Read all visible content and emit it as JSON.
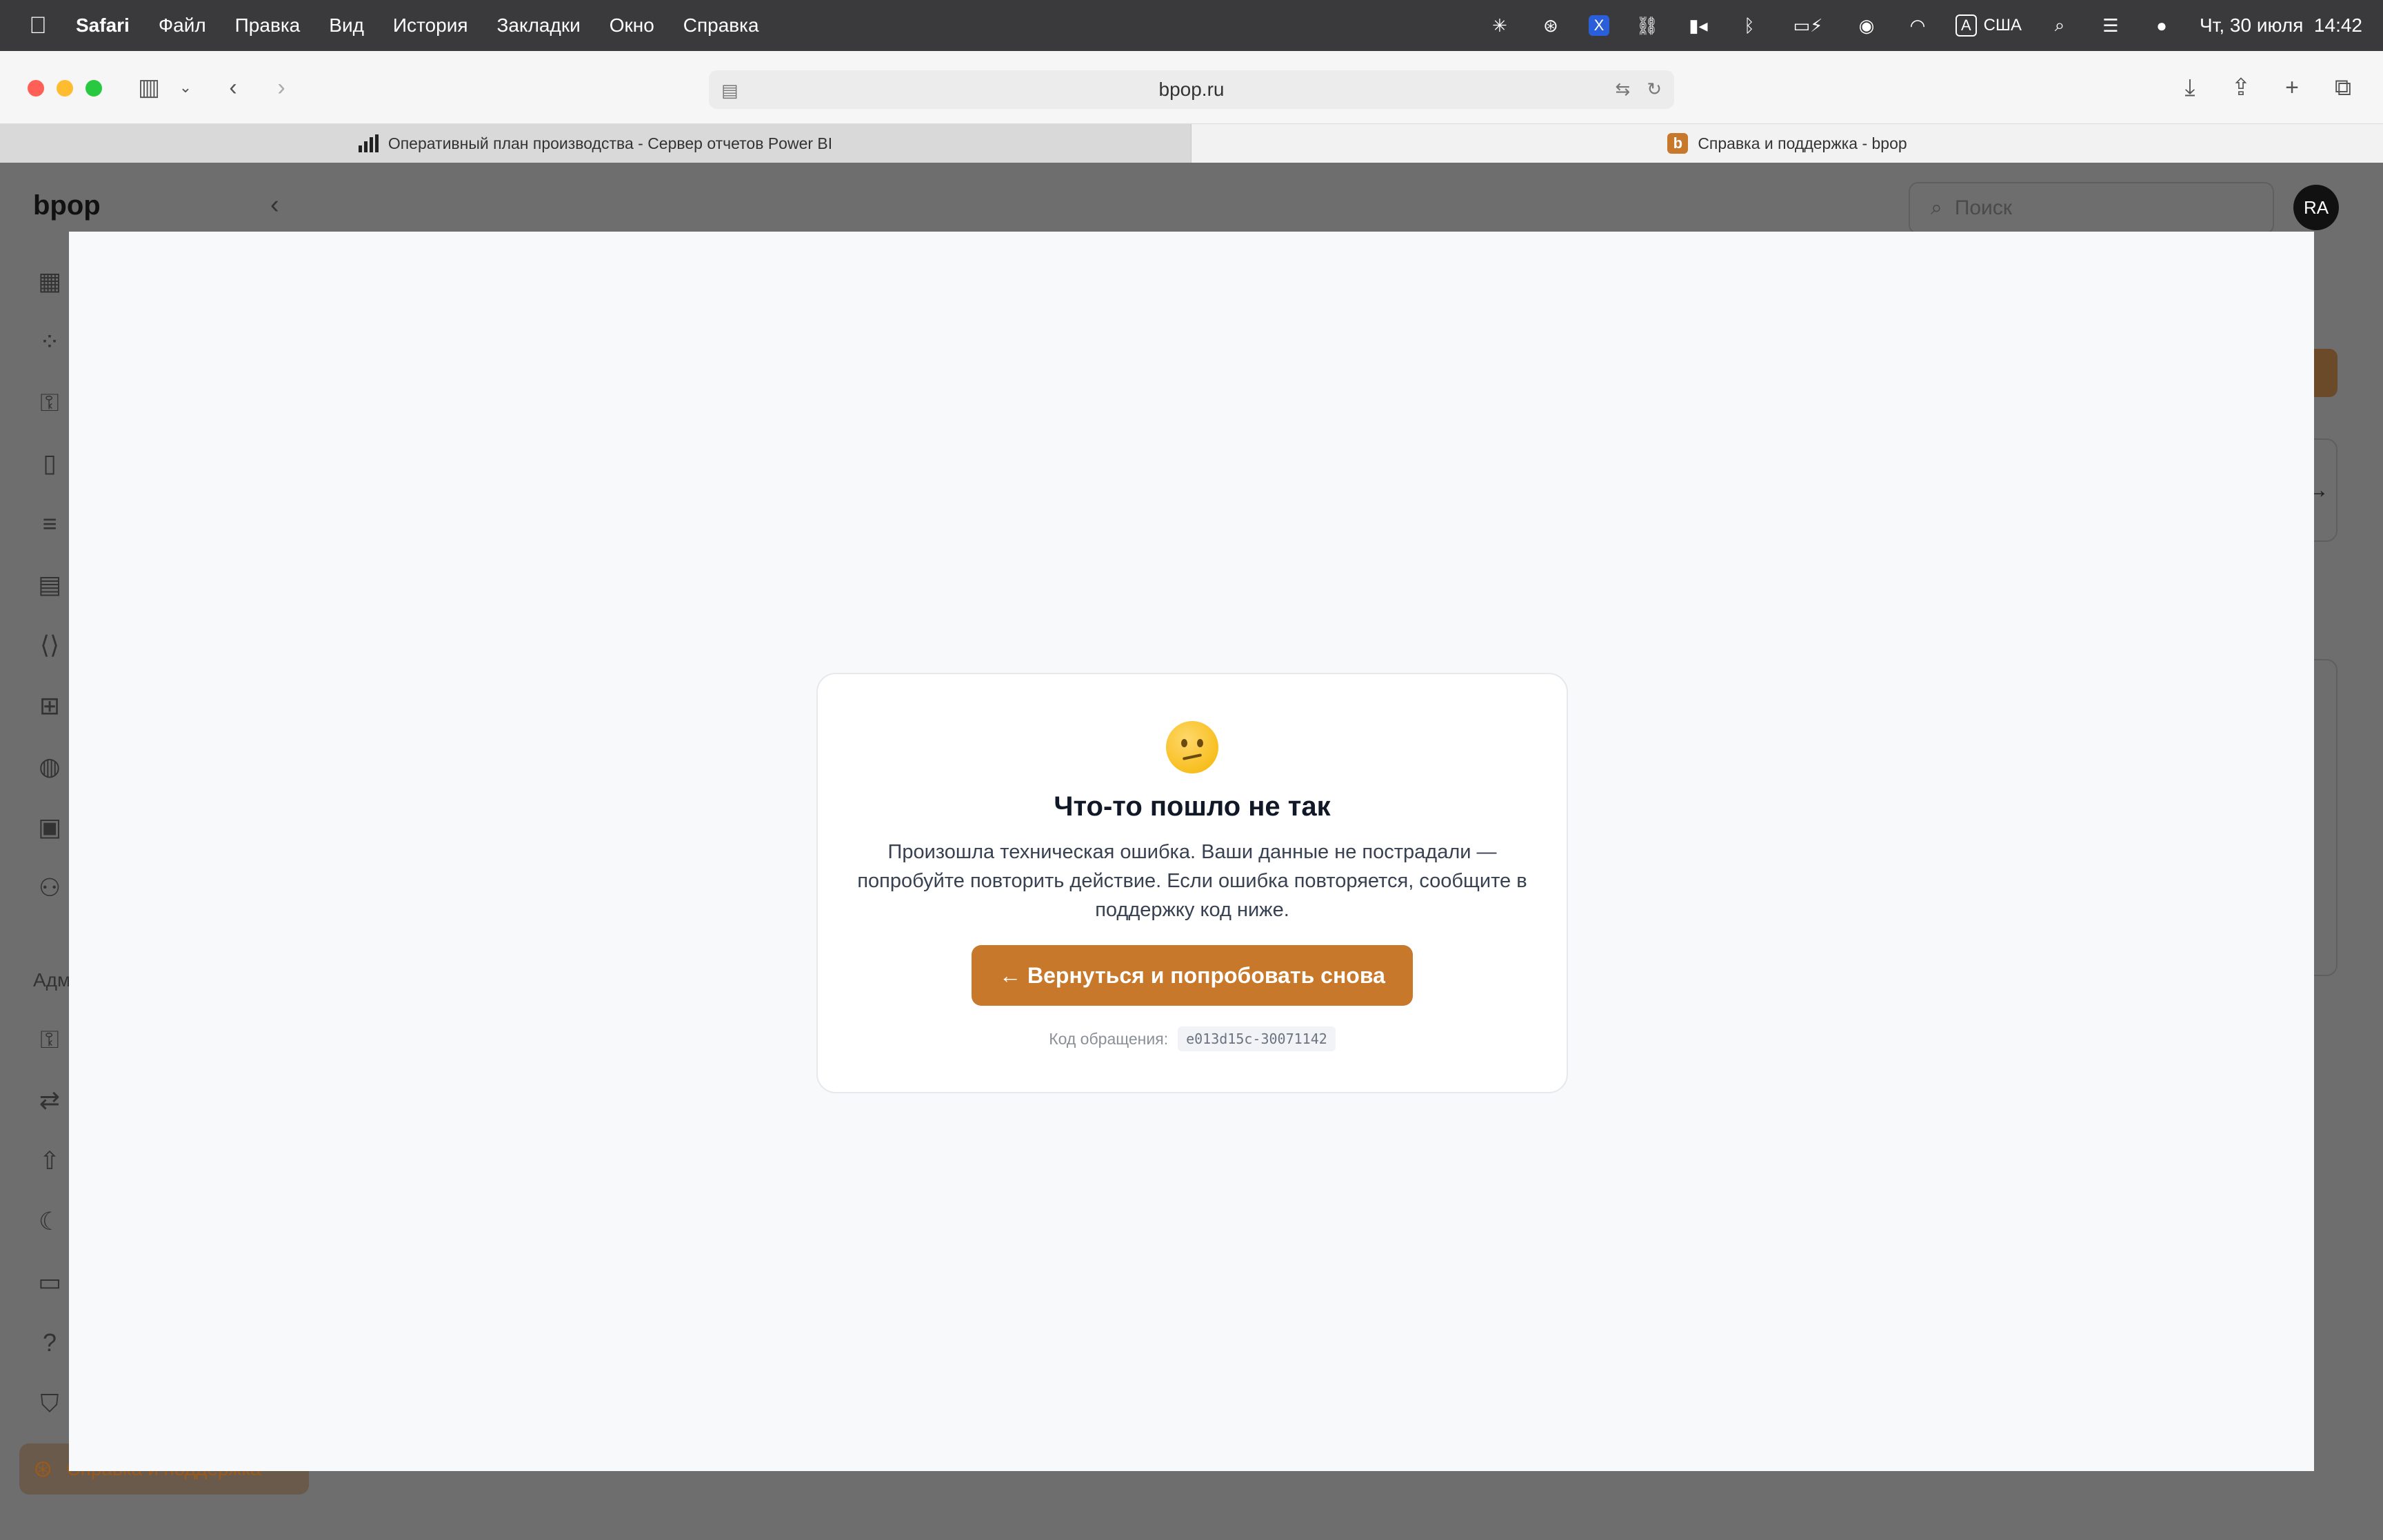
{
  "menubar": {
    "app": "Safari",
    "items": [
      "Файл",
      "Правка",
      "Вид",
      "История",
      "Закладки",
      "Окно",
      "Справка"
    ],
    "keyboard_layout_badge": "A",
    "keyboard_layout": "США",
    "datetime": "Чт, 30 июля  14:42"
  },
  "browser": {
    "url": "bpop.ru",
    "tabs": [
      {
        "title": "Оперативный план производства - Сервер отчетов Power BI",
        "active": false
      },
      {
        "title": "Справка и поддержка - bpop",
        "active": true,
        "favicon_letter": "b"
      }
    ]
  },
  "app": {
    "logo": "bpop",
    "search_placeholder": "Поиск",
    "avatar_initials": "RA",
    "admin_section_label": "Адм",
    "help_item_label": "Справка и поддержка",
    "accent_color": "#c8782a"
  },
  "error": {
    "title": "Что-то пошло не так",
    "message": "Произошла техническая ошибка. Ваши данные не пострадали — попробуйте повторить действие. Если ошибка повторяется, сообщите в поддержку код ниже.",
    "retry_label": "← Вернуться и попробовать снова",
    "reference_label": "Код обращения:",
    "reference_code": "e013d15c-30071142"
  }
}
